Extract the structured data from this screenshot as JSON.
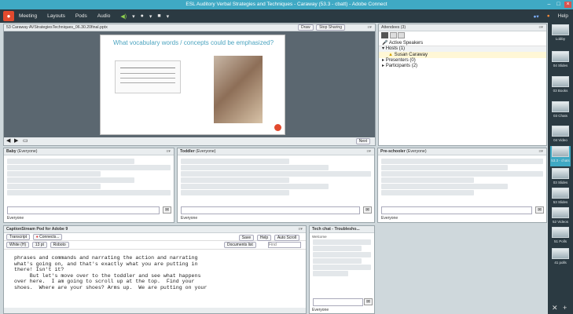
{
  "window": {
    "title": "ESL Auditory Verbal Strategies and Techniques - Caraway (53.3 - cbatt) - Adobe Connect",
    "controls": [
      "–",
      "□",
      "×"
    ]
  },
  "menubar": {
    "items": [
      "Meeting",
      "Layouts",
      "Pods",
      "Audio"
    ],
    "help": "Help"
  },
  "share_pod": {
    "title": "53 Caraway AVStrategiesTechniques_06.30.20final.pptx",
    "buttons": [
      "Draw",
      "Stop Sharing"
    ],
    "slide_title": "What vocabulary words / concepts could be emphasized?",
    "next_label": "Next"
  },
  "attendees": {
    "title": "Attendees (3)",
    "active_speakers": "Active Speakers",
    "groups": [
      "Hosts (1)",
      "Presenters (0)",
      "Participants (2)"
    ],
    "host_name": "Susan Caraway"
  },
  "chat_pods": [
    {
      "title": "Baby",
      "scope": "(Everyone)",
      "recipient": "Everyone"
    },
    {
      "title": "Toddler",
      "scope": "(Everyone)",
      "recipient": "Everyone"
    },
    {
      "title": "Pre-schooler",
      "scope": "(Everyone)",
      "recipient": "Everyone"
    }
  ],
  "caption_pod": {
    "title": "CaptionStream Pod for Adobe 9",
    "tabs": [
      "Transcript",
      "Connects..."
    ],
    "toolbar": [
      "White (H)",
      "13 pt",
      "Roboto"
    ],
    "buttons": [
      "Save",
      "Help",
      "Auto Scroll"
    ],
    "doc_label": "Documents list",
    "find_placeholder": "Find",
    "transcript": "phrases and commands and narrating the action and narrating\nwhat's going on, and that's exactly what you are putting in\nthere! Isn't it?\n     But let's move over to the toddler and see what happens\nover here.  I am going to scroll up at the top.  Find your\nshoes.  Where are your shoes? Arms up.  We are putting on your"
  },
  "tech_chat": {
    "title": "Tech chat - Troublesho...",
    "first_line": "Welcome",
    "recipient": "Everyone"
  },
  "sidebar_tiles": [
    "Lobby",
    "04 Slides",
    "03 Books",
    "03 Chats",
    "04 Video",
    "53.3 - chats",
    "03 Slides",
    "53 Slides",
    "52 Videos",
    "51 Polls",
    "41 polls"
  ],
  "colors": {
    "titlebar": "#3fa9c4",
    "menubar": "#2b3a42",
    "accent": "#4aa3bf"
  }
}
